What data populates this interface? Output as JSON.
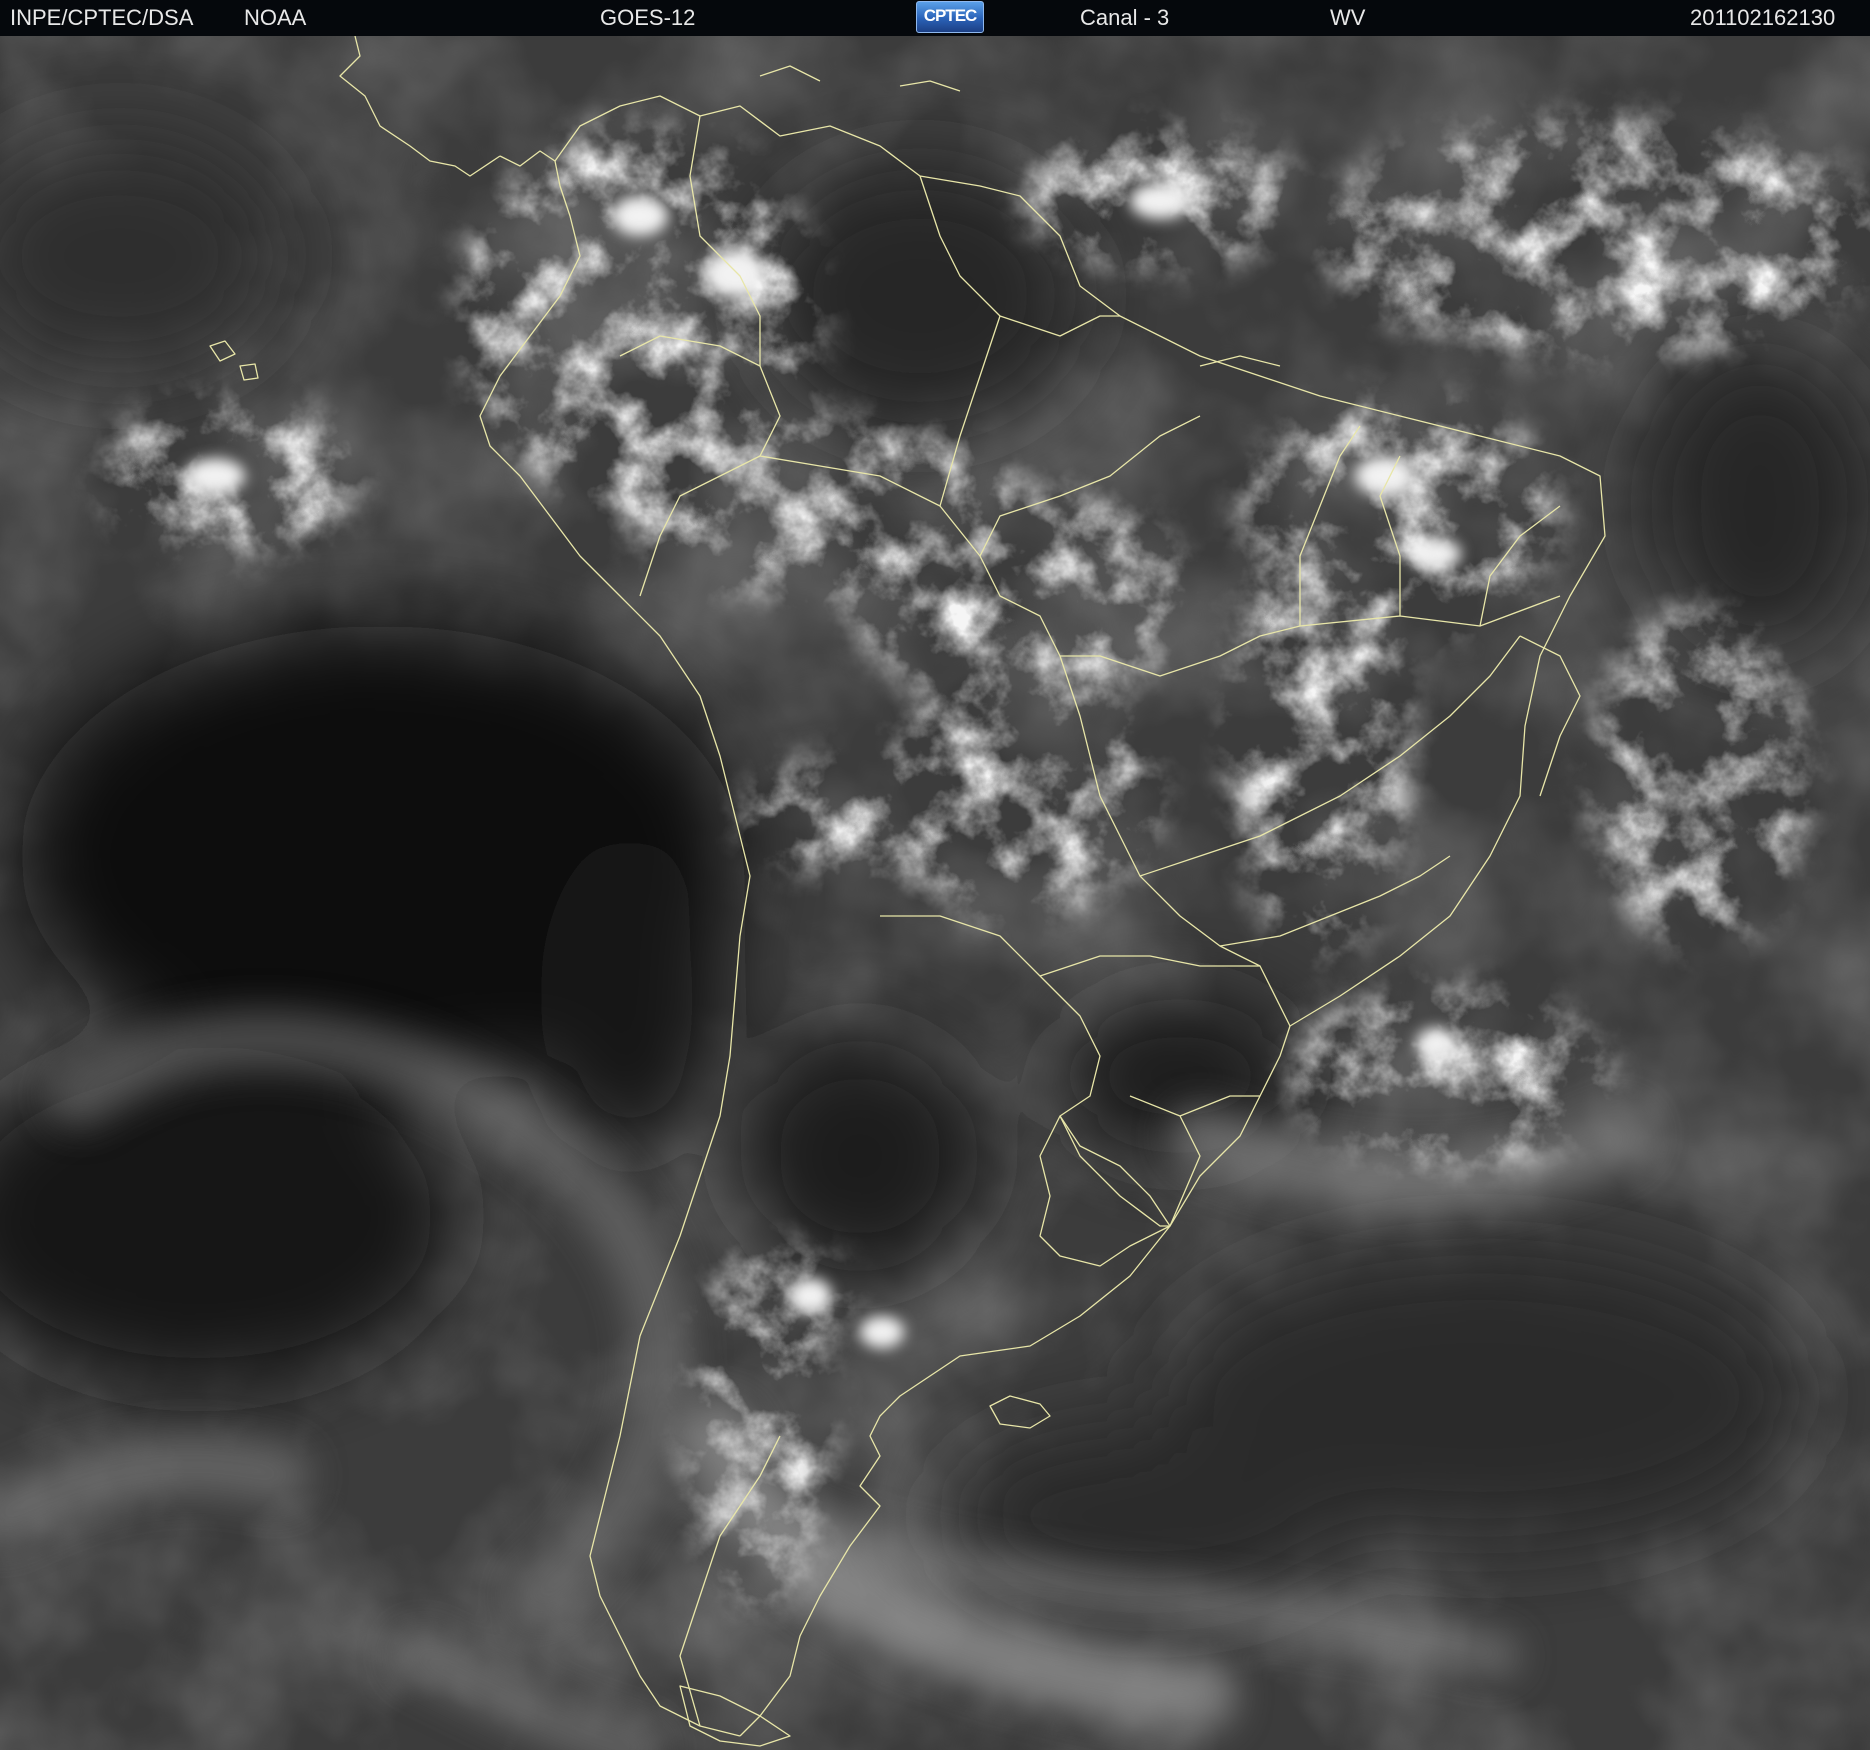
{
  "header": {
    "institution": "INPE/CPTEC/DSA",
    "agency": "NOAA",
    "satellite": "GOES-12",
    "logo_text": "CPTEC",
    "channel": "Canal - 3",
    "band": "WV",
    "timestamp": "201102162130"
  },
  "image": {
    "subject": "water-vapor-satellite-image-south-america",
    "overlay_color": "#e8e6a8"
  }
}
